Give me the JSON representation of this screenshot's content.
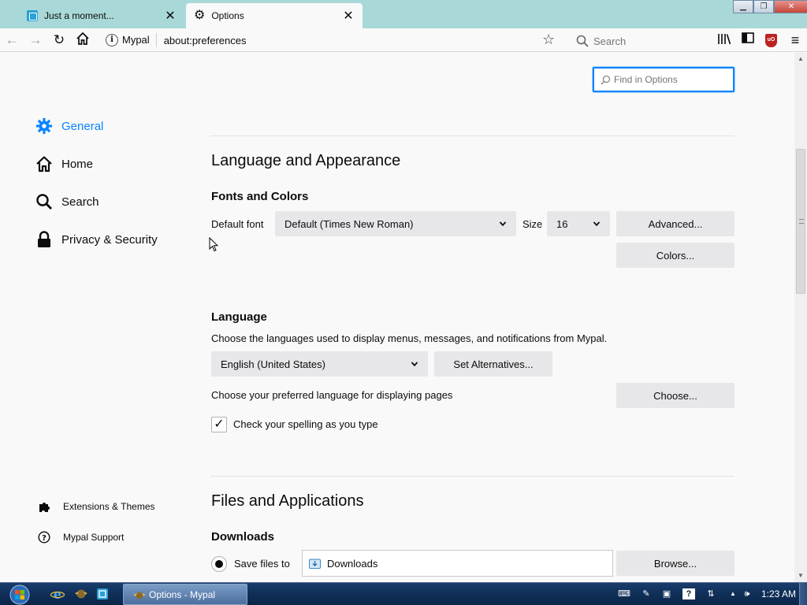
{
  "window": {
    "tabs": [
      {
        "title": "Just a moment...",
        "active": false
      },
      {
        "title": "Options",
        "active": true
      }
    ]
  },
  "navbar": {
    "site_label": "Mypal",
    "url": "about:preferences",
    "search_placeholder": "Search"
  },
  "preferences": {
    "find_placeholder": "Find in Options",
    "categories": [
      {
        "label": "General",
        "icon": "gear-icon",
        "selected": true
      },
      {
        "label": "Home",
        "icon": "home-icon"
      },
      {
        "label": "Search",
        "icon": "search-icon"
      },
      {
        "label": "Privacy & Security",
        "icon": "lock-icon"
      }
    ],
    "footer_links": [
      {
        "label": "Extensions & Themes",
        "icon": "puzzle-icon"
      },
      {
        "label": "Mypal Support",
        "icon": "help-icon"
      }
    ],
    "language_appearance": {
      "heading": "Language and Appearance",
      "fonts_colors_heading": "Fonts and Colors",
      "default_font_label": "Default font",
      "default_font_value": "Default (Times New Roman)",
      "size_label": "Size",
      "size_value": "16",
      "advanced_button": "Advanced...",
      "colors_button": "Colors..."
    },
    "language": {
      "heading": "Language",
      "description": "Choose the languages used to display menus, messages, and notifications from Mypal.",
      "ui_language_value": "English (United States)",
      "set_alternatives_button": "Set Alternatives...",
      "page_language_label": "Choose your preferred language for displaying pages",
      "choose_button": "Choose...",
      "spellcheck_label": "Check your spelling as you type",
      "spellcheck_checked": true
    },
    "files_applications": {
      "heading": "Files and Applications",
      "downloads_heading": "Downloads",
      "save_files_label": "Save files to",
      "save_files_selected": true,
      "download_folder": "Downloads",
      "browse_button": "Browse..."
    }
  },
  "taskbar": {
    "task_label": "Options - Mypal",
    "clock": "1:23 AM"
  },
  "colors": {
    "accent": "#0a84ff",
    "tabstrip": "#a9d8d8",
    "page_bg": "#f9f9fa",
    "button_bg": "#e7e7e9"
  }
}
